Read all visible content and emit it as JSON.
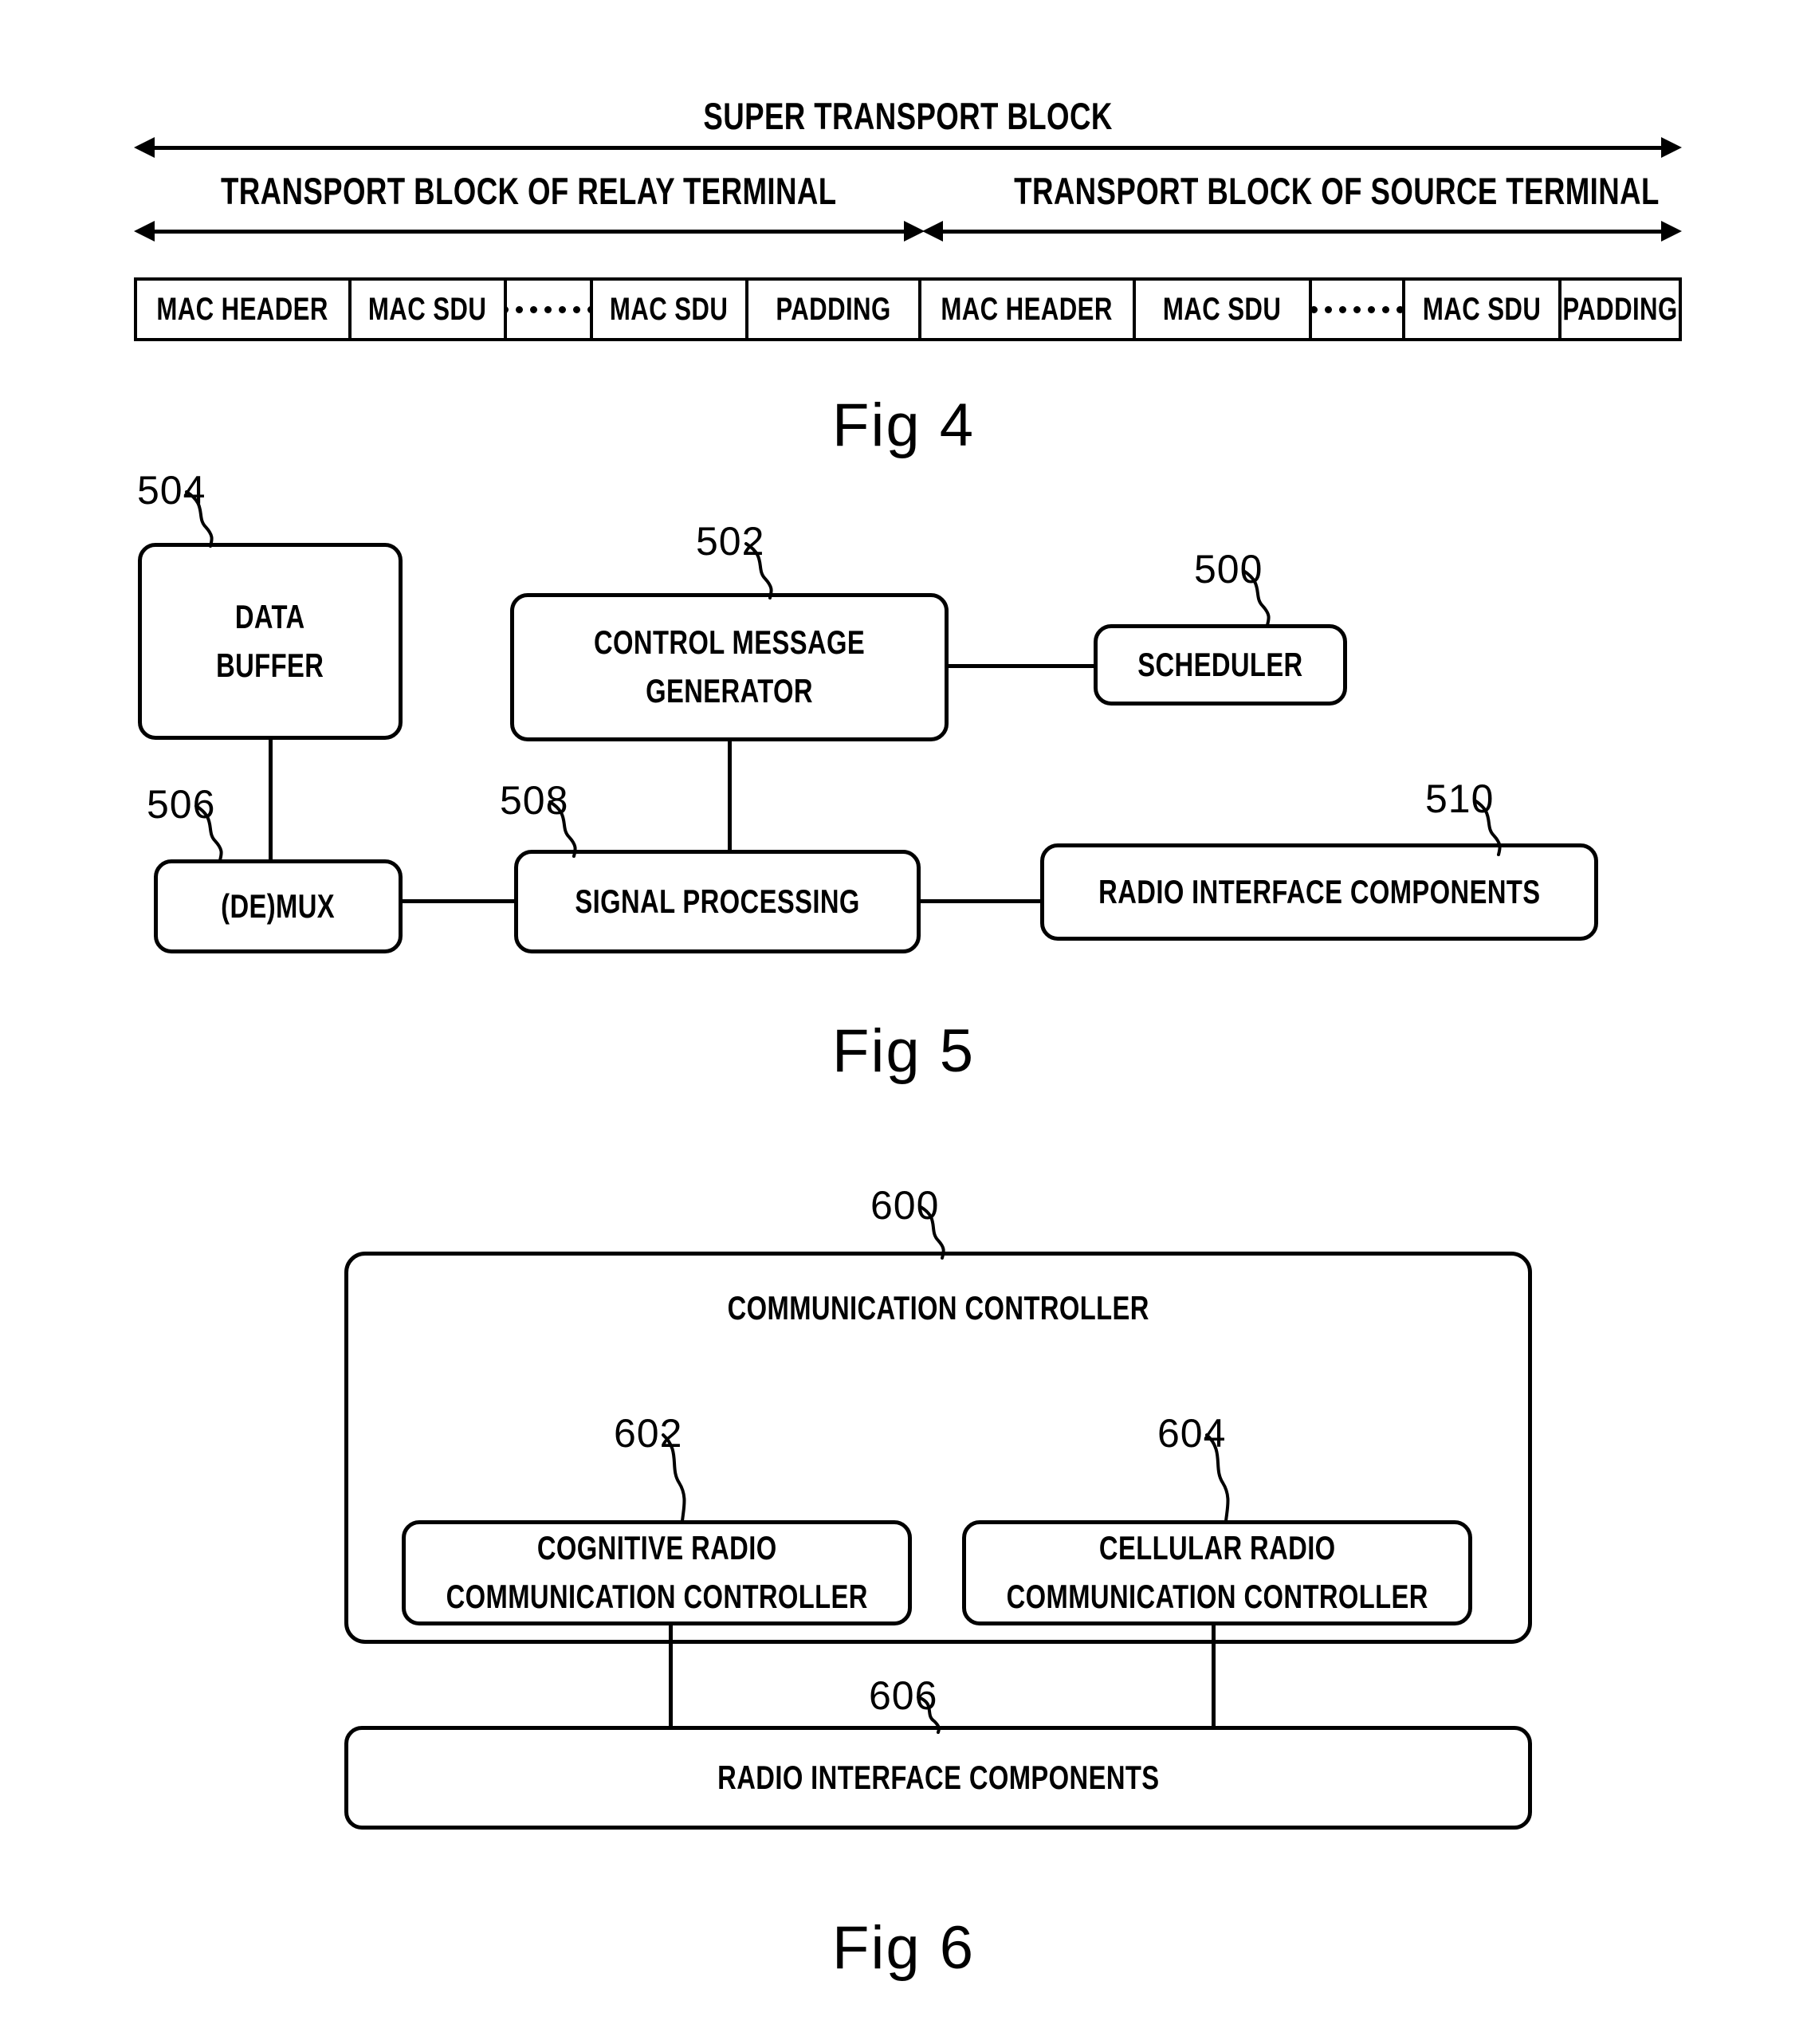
{
  "document": {
    "type": "patent-drawing-sheet",
    "figures": [
      "Fig 4",
      "Fig 5",
      "Fig 6"
    ]
  },
  "fig4": {
    "caption": "Fig 4",
    "super_label": "SUPER TRANSPORT BLOCK",
    "left_label": "TRANSPORT BLOCK OF RELAY TERMINAL",
    "right_label": "TRANSPORT BLOCK OF SOURCE TERMINAL",
    "cells": [
      {
        "text": "MAC HEADER",
        "kind": "text"
      },
      {
        "text": "MAC SDU",
        "kind": "text"
      },
      {
        "text": "",
        "kind": "dots"
      },
      {
        "text": "MAC SDU",
        "kind": "text"
      },
      {
        "text": "PADDING",
        "kind": "text"
      },
      {
        "text": "MAC HEADER",
        "kind": "text"
      },
      {
        "text": "MAC SDU",
        "kind": "text"
      },
      {
        "text": "",
        "kind": "dots"
      },
      {
        "text": "MAC SDU",
        "kind": "text"
      },
      {
        "text": "PADDING",
        "kind": "text"
      }
    ]
  },
  "fig5": {
    "caption": "Fig 5",
    "blocks": [
      {
        "ref": "504",
        "label": "DATA\nBUFFER",
        "label_line1": "DATA",
        "label_line2": "BUFFER"
      },
      {
        "ref": "502",
        "label": "CONTROL MESSAGE GENERATOR",
        "label_line1": "CONTROL MESSAGE",
        "label_line2": "GENERATOR"
      },
      {
        "ref": "500",
        "label": "SCHEDULER",
        "label_line1": "SCHEDULER",
        "label_line2": ""
      },
      {
        "ref": "506",
        "label": "(DE)MUX",
        "label_line1": "(DE)MUX",
        "label_line2": ""
      },
      {
        "ref": "508",
        "label": "SIGNAL PROCESSING",
        "label_line1": "SIGNAL PROCESSING",
        "label_line2": ""
      },
      {
        "ref": "510",
        "label": "RADIO INTERFACE COMPONENTS",
        "label_line1": "RADIO INTERFACE COMPONENTS",
        "label_line2": ""
      }
    ]
  },
  "fig6": {
    "caption": "Fig 6",
    "blocks": [
      {
        "ref": "600",
        "label": "COMMUNICATION CONTROLLER"
      },
      {
        "ref": "602",
        "label_line1": "COGNITIVE RADIO",
        "label_line2": "COMMUNICATION CONTROLLER"
      },
      {
        "ref": "604",
        "label_line1": "CELLULAR RADIO",
        "label_line2": "COMMUNICATION CONTROLLER"
      },
      {
        "ref": "606",
        "label": "RADIO INTERFACE COMPONENTS"
      }
    ]
  },
  "colors": {
    "ink": "#000000",
    "paper": "#ffffff"
  }
}
